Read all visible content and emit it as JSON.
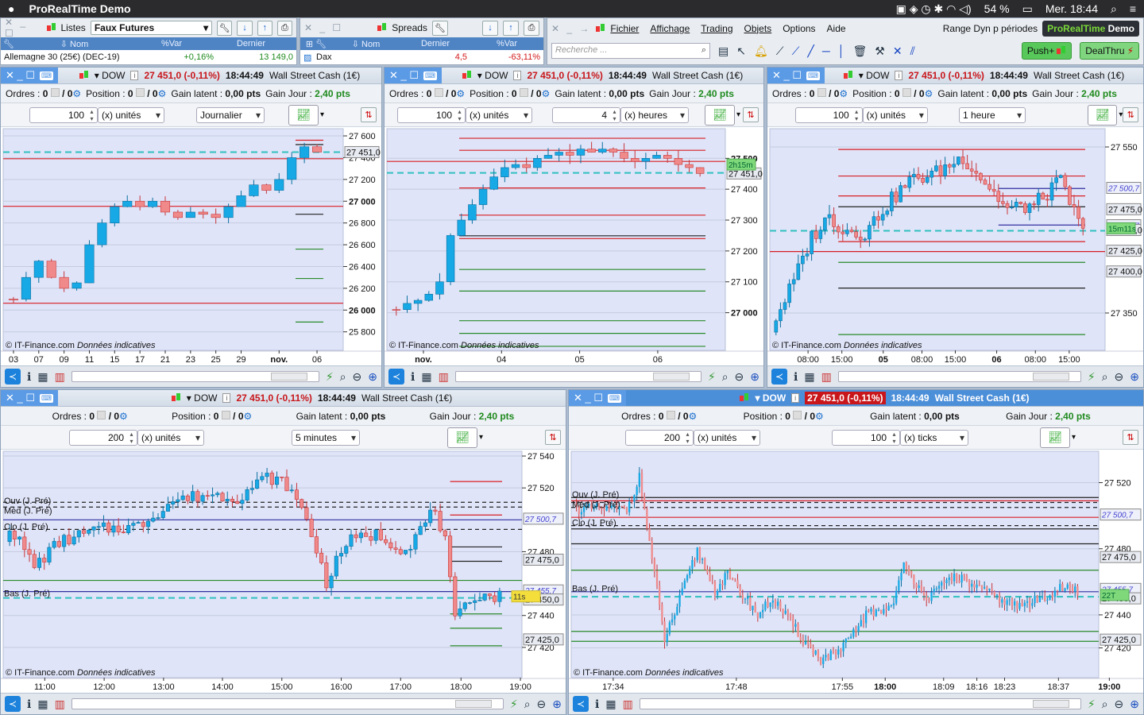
{
  "menubar": {
    "app": "ProRealTime Demo",
    "battery": "54 %",
    "datetime": "Mer. 18:44"
  },
  "lists": {
    "title": "Listes",
    "selected": "Faux Futures",
    "columns": [
      "⇩ Nom",
      "%Var",
      "Dernier"
    ],
    "rows": [
      {
        "name": "Allemagne 30 (25€) (DEC-19)",
        "var": "+0,16%",
        "last": "13 149,0"
      }
    ]
  },
  "spreads": {
    "title": "Spreads",
    "columns": [
      "⇩ Nom",
      "Dernier",
      "%Var"
    ],
    "rows": [
      {
        "name": "Dax",
        "last": "4,5",
        "var": "-63,11%"
      }
    ]
  },
  "main": {
    "menu": [
      "Fichier",
      "Affichage",
      "Trading",
      "Objets",
      "Options",
      "Aide"
    ],
    "range": "Range Dyn p périodes",
    "brand1": "ProRealTime",
    "brand2": " Demo",
    "search_placeholder": "Recherche ...",
    "push": "Push+",
    "dealthru": "DealThru"
  },
  "common": {
    "symbol": "DOW",
    "price": "27 451,0 (-0,11%)",
    "time": "18:44:49",
    "instrument": "Wall Street Cash (1€)",
    "orders": "Ordres :",
    "position": "Position :",
    "zero": "0",
    "slash_zero": "/ 0",
    "gain_latent": "Gain latent :",
    "gain_latent_val": "0,00 pts",
    "gain_jour": "Gain Jour :",
    "gain_jour_val": "2,40 pts",
    "copyright": "© IT-Finance.com",
    "indicative": "Données indicatives"
  },
  "panels": [
    {
      "units": "100",
      "unit_label": "(x) unités",
      "period": "Journalier"
    },
    {
      "units": "100",
      "unit_label": "(x) unités",
      "period2": "4",
      "period2_label": "(x) heures"
    },
    {
      "units": "100",
      "unit_label": "(x) unités",
      "period": "1 heure"
    },
    {
      "units": "200",
      "unit_label": "(x) unités",
      "period": "5 minutes"
    },
    {
      "units": "200",
      "unit_label": "(x) unités",
      "period2": "100",
      "period2_label": "(x) ticks"
    }
  ],
  "chart_data": [
    {
      "type": "candlestick",
      "ylim": [
        25630,
        27666
      ],
      "closes": [
        26100,
        26300,
        26450,
        26300,
        26200,
        26250,
        26600,
        26800,
        26950,
        27000,
        26950,
        27000,
        26900,
        26850,
        26900,
        26880,
        26850,
        26950,
        27050,
        27150,
        27100,
        27200,
        27400,
        27500,
        27451
      ],
      "vol": 60,
      "yticks": [
        {
          "v": 27600,
          "t": "27 600"
        },
        {
          "v": 27400,
          "t": "27 400"
        },
        {
          "v": 27200,
          "t": "27 200"
        },
        {
          "v": 27000,
          "t": "27 000",
          "b": 1
        },
        {
          "v": 26800,
          "t": "26 800"
        },
        {
          "v": 26600,
          "t": "26 600"
        },
        {
          "v": 26400,
          "t": "26 400"
        },
        {
          "v": 26200,
          "t": "26 200"
        },
        {
          "v": 26000,
          "t": "26 000",
          "b": 1
        },
        {
          "v": 25800,
          "t": "25 800"
        }
      ],
      "xticks": [
        {
          "i": 0,
          "t": "03"
        },
        {
          "i": 2,
          "t": "07"
        },
        {
          "i": 4,
          "t": "09"
        },
        {
          "i": 6,
          "t": "11"
        },
        {
          "i": 8,
          "t": "15"
        },
        {
          "i": 10,
          "t": "17"
        },
        {
          "i": 12,
          "t": "21"
        },
        {
          "i": 14,
          "t": "23"
        },
        {
          "i": 16,
          "t": "25"
        },
        {
          "i": 18,
          "t": "29"
        },
        {
          "i": 21,
          "t": "nov.",
          "b": 1
        },
        {
          "i": 24,
          "t": "06"
        }
      ],
      "lines": [
        {
          "p": 27390,
          "c": "#d81e24"
        },
        {
          "p": 26953,
          "c": "#d81e24"
        },
        {
          "p": 26063,
          "c": "#d81e24"
        },
        {
          "p": 27451,
          "c": "#30c0c0",
          "d": "8,5",
          "w": 2
        },
        {
          "p": 27560,
          "c": "#d81e24",
          "from": 22.3
        },
        {
          "p": 27520,
          "c": "#222",
          "from": 22.3
        },
        {
          "p": 26880,
          "c": "#222",
          "from": 22.3
        },
        {
          "p": 26560,
          "c": "#2a8a2a",
          "from": 22.3
        },
        {
          "p": 26290,
          "c": "#2a8a2a",
          "from": 22.3
        },
        {
          "p": 25890,
          "c": "#2a8a2a",
          "from": 22.3
        }
      ],
      "labels": [
        {
          "v": 27451,
          "t": "27 451,0",
          "s": "box"
        }
      ]
    },
    {
      "type": "candlestick",
      "ylim": [
        26878,
        27596
      ],
      "closes": [
        27010,
        27030,
        27040,
        27060,
        27100,
        27250,
        27300,
        27350,
        27400,
        27440,
        27470,
        27480,
        27470,
        27500,
        27510,
        27520,
        27510,
        27530,
        27520,
        27530,
        27520,
        27500,
        27490,
        27500,
        27510,
        27500,
        27480,
        27470,
        27451
      ],
      "vol": 30,
      "yticks": [
        {
          "v": 27500,
          "t": "27 500",
          "b": 1
        },
        {
          "v": 27400,
          "t": "27 400"
        },
        {
          "v": 27300,
          "t": "27 300"
        },
        {
          "v": 27200,
          "t": "27 200"
        },
        {
          "v": 27100,
          "t": "27 100"
        },
        {
          "v": 27000,
          "t": "27 000",
          "b": 1
        }
      ],
      "xticks": [
        {
          "i": 2.5,
          "t": "nov.",
          "b": 1
        },
        {
          "i": 9.7,
          "t": "04"
        },
        {
          "i": 16.9,
          "t": "05"
        },
        {
          "i": 24.1,
          "t": "06"
        }
      ],
      "lines": [
        {
          "p": 27490,
          "c": "#d81e24"
        },
        {
          "p": 27453,
          "c": "#30c0c0",
          "d": "8,5",
          "w": 2
        },
        {
          "p": 27565,
          "c": "#d81e24",
          "from": 5.8
        },
        {
          "p": 27526,
          "c": "#d81e24",
          "from": 5.8
        },
        {
          "p": 27404,
          "c": "#d81e24",
          "from": 5.8
        },
        {
          "p": 27316,
          "c": "#d81e24",
          "from": 5.8
        },
        {
          "p": 27249,
          "c": "#222",
          "from": 5.8
        },
        {
          "p": 27240,
          "c": "#d81e24",
          "from": 5.8
        },
        {
          "p": 27140,
          "c": "#2a8a2a",
          "from": 5.8
        },
        {
          "p": 27070,
          "c": "#2a8a2a",
          "from": 5.8
        },
        {
          "p": 26974,
          "c": "#2a8a2a",
          "from": 5.8
        },
        {
          "p": 26933,
          "c": "#2a8a2a",
          "from": 5.8
        },
        {
          "p": 26891,
          "c": "#2a8a2a",
          "from": 5.8
        }
      ],
      "labels": [
        {
          "v": 27451,
          "t": "27 451,0",
          "s": "box"
        },
        {
          "v": 27480,
          "t": "2h15m",
          "s": "green"
        }
      ]
    },
    {
      "type": "candlestick",
      "ylim": [
        27305,
        27572
      ],
      "n": 70,
      "vol": 12,
      "seed": 3,
      "path": [
        [
          0,
          27345
        ],
        [
          4,
          27388
        ],
        [
          8,
          27442
        ],
        [
          12,
          27466
        ],
        [
          15,
          27451
        ],
        [
          20,
          27446
        ],
        [
          24,
          27475
        ],
        [
          30,
          27509
        ],
        [
          36,
          27519
        ],
        [
          42,
          27538
        ],
        [
          46,
          27514
        ],
        [
          52,
          27475
        ],
        [
          58,
          27480
        ],
        [
          64,
          27509
        ],
        [
          69,
          27446
        ]
      ],
      "yticks": [
        {
          "v": 27550,
          "t": "27 550"
        },
        {
          "v": 27350,
          "t": "27 350"
        }
      ],
      "xticks": [
        {
          "i": 7.2,
          "t": "08:00"
        },
        {
          "i": 14.8,
          "t": "15:00"
        },
        {
          "i": 24.1,
          "t": "05",
          "b": 1
        },
        {
          "i": 32.8,
          "t": "08:00"
        },
        {
          "i": 40.3,
          "t": "15:00"
        },
        {
          "i": 49.6,
          "t": "06",
          "b": 1
        },
        {
          "i": 58.3,
          "t": "08:00"
        },
        {
          "i": 65.9,
          "t": "15:00"
        }
      ],
      "lines": [
        {
          "p": 27424,
          "c": "#d81e24"
        },
        {
          "p": 27449,
          "c": "#30c0c0",
          "d": "8,5",
          "w": 2
        },
        {
          "p": 27547,
          "c": "#d81e24",
          "from": 14
        },
        {
          "p": 27515,
          "c": "#d81e24",
          "from": 14
        },
        {
          "p": 27491,
          "c": "#d81e24",
          "from": 14
        },
        {
          "p": 27478,
          "c": "#222",
          "from": 14
        },
        {
          "p": 27436,
          "c": "#d81e24",
          "from": 14
        },
        {
          "p": 27411,
          "c": "#2a8a2a",
          "from": 14
        },
        {
          "p": 27380,
          "c": "#222",
          "from": 14
        },
        {
          "p": 27324,
          "c": "#2a8a2a",
          "from": 14
        },
        {
          "p": 27500,
          "c": "#3030a0",
          "from": 50
        },
        {
          "p": 27456,
          "c": "#3030a0",
          "from": 50
        }
      ],
      "labels": [
        {
          "v": 27500.7,
          "t": "27 500,7",
          "s": "purple"
        },
        {
          "v": 27475,
          "t": "27 475,0",
          "s": "box"
        },
        {
          "v": 27455.7,
          "t": "27 455,7",
          "s": "purple"
        },
        {
          "v": 27450,
          "t": "27 450,0",
          "s": "box"
        },
        {
          "v": 27452,
          "t": "15m11s",
          "s": "green"
        },
        {
          "v": 27425,
          "t": "27 425,0",
          "s": "box"
        },
        {
          "v": 27400,
          "t": "27 400,0",
          "s": "box"
        }
      ]
    },
    {
      "type": "candlestick",
      "ylim": [
        27401,
        27543
      ],
      "n": 100,
      "vol": 5,
      "seed": 7,
      "path": [
        [
          0,
          27496
        ],
        [
          5,
          27471
        ],
        [
          10,
          27486
        ],
        [
          18,
          27494
        ],
        [
          26,
          27496
        ],
        [
          33,
          27512
        ],
        [
          40,
          27516
        ],
        [
          46,
          27514
        ],
        [
          52,
          27527
        ],
        [
          56,
          27522
        ],
        [
          60,
          27501
        ],
        [
          64,
          27461
        ],
        [
          68,
          27486
        ],
        [
          74,
          27491
        ],
        [
          80,
          27481
        ],
        [
          86,
          27507
        ],
        [
          88,
          27486
        ],
        [
          90,
          27436
        ],
        [
          94,
          27453
        ],
        [
          99,
          27452
        ]
      ],
      "yticks": [
        {
          "v": 27540,
          "t": "27 540"
        },
        {
          "v": 27520,
          "t": "27 520"
        },
        {
          "v": 27480,
          "t": "27 480"
        },
        {
          "v": 27440,
          "t": "27 440"
        },
        {
          "v": 27420,
          "t": "27 420"
        }
      ],
      "xticks": [
        {
          "i": 7.1,
          "t": "11:00"
        },
        {
          "i": 19.1,
          "t": "12:00"
        },
        {
          "i": 31.1,
          "t": "13:00"
        },
        {
          "i": 43,
          "t": "14:00"
        },
        {
          "i": 55,
          "t": "15:00"
        },
        {
          "i": 67,
          "t": "16:00"
        },
        {
          "i": 79,
          "t": "17:00"
        },
        {
          "i": 91.2,
          "t": "18:00"
        },
        {
          "i": 103.2,
          "t": "19:00"
        }
      ],
      "lines": [
        {
          "p": 27511,
          "c": "#222",
          "d": "5,4"
        },
        {
          "p": 27508,
          "c": "#222",
          "d": "5,4"
        },
        {
          "p": 27494,
          "c": "#222",
          "d": "5,4"
        },
        {
          "p": 27500,
          "c": "#3030a0"
        },
        {
          "p": 27462,
          "c": "#2a8a2a"
        },
        {
          "p": 27455,
          "c": "#3030a0"
        },
        {
          "p": 27451,
          "c": "#30c0c0",
          "d": "8,5",
          "w": 2
        },
        {
          "p": 27524,
          "c": "#d81e24",
          "from": 89
        },
        {
          "p": 27503,
          "c": "#d81e24",
          "from": 89
        },
        {
          "p": 27483,
          "c": "#222",
          "from": 89
        },
        {
          "p": 27474,
          "c": "#222",
          "from": 89
        },
        {
          "p": 27441,
          "c": "#2a8a2a",
          "from": 89
        },
        {
          "p": 27432,
          "c": "#2a8a2a",
          "from": 89
        },
        {
          "p": 27421,
          "c": "#2a8a2a",
          "from": 89
        }
      ],
      "tags": [
        {
          "v": 27512,
          "t": "Ouv (J. Pré)"
        },
        {
          "v": 27506,
          "t": "Méd (J. Pré)"
        },
        {
          "v": 27496,
          "t": "Clo (J. Pré)"
        },
        {
          "v": 27454,
          "t": "Bas (J. Pré)"
        }
      ],
      "labels": [
        {
          "v": 27500.7,
          "t": "27 500,7",
          "s": "purple"
        },
        {
          "v": 27475,
          "t": "27 475,0",
          "s": "box"
        },
        {
          "v": 27455.7,
          "t": "27 455,7",
          "s": "purple"
        },
        {
          "v": 27450,
          "t": "27 450,0",
          "s": "box"
        },
        {
          "v": 27452,
          "t": "11s",
          "s": "yellow"
        },
        {
          "v": 27425,
          "t": "27 425,0",
          "s": "box"
        }
      ]
    },
    {
      "type": "candlestick",
      "ylim": [
        27402,
        27539
      ],
      "n": 200,
      "vol": 4,
      "seed": 11,
      "path": [
        [
          0,
          27504
        ],
        [
          20,
          27504
        ],
        [
          25,
          27523
        ],
        [
          30,
          27474
        ],
        [
          35,
          27425
        ],
        [
          40,
          27445
        ],
        [
          48,
          27479
        ],
        [
          55,
          27455
        ],
        [
          60,
          27464
        ],
        [
          72,
          27440
        ],
        [
          78,
          27450
        ],
        [
          90,
          27425
        ],
        [
          97,
          27413
        ],
        [
          105,
          27418
        ],
        [
          115,
          27440
        ],
        [
          125,
          27445
        ],
        [
          130,
          27469
        ],
        [
          140,
          27450
        ],
        [
          150,
          27464
        ],
        [
          165,
          27452
        ],
        [
          175,
          27445
        ],
        [
          185,
          27450
        ],
        [
          192,
          27457
        ],
        [
          199,
          27454
        ]
      ],
      "yticks": [
        {
          "v": 27520,
          "t": "27 520"
        },
        {
          "v": 27480,
          "t": "27 480"
        },
        {
          "v": 27440,
          "t": "27 440"
        },
        {
          "v": 27420,
          "t": "27 420"
        }
      ],
      "xticks": [
        {
          "i": 14.6,
          "t": "17:34"
        },
        {
          "i": 63.5,
          "t": "17:48"
        },
        {
          "i": 105.6,
          "t": "17:55"
        },
        {
          "i": 122.6,
          "t": "18:00",
          "b": 1
        },
        {
          "i": 145.8,
          "t": "18:09"
        },
        {
          "i": 159,
          "t": "18:16"
        },
        {
          "i": 170,
          "t": "18:23"
        },
        {
          "i": 191.4,
          "t": "18:37"
        },
        {
          "i": 211.6,
          "t": "19:00",
          "b": 1
        }
      ],
      "lines": [
        {
          "p": 27508,
          "c": "#222",
          "d": "5,4"
        },
        {
          "p": 27505,
          "c": "#222",
          "d": "5,4"
        },
        {
          "p": 27494,
          "c": "#222",
          "d": "5,4"
        },
        {
          "p": 27511,
          "c": "#222"
        },
        {
          "p": 27509,
          "c": "#d81e24"
        },
        {
          "p": 27499,
          "c": "#d81e24"
        },
        {
          "p": 27492,
          "c": "#222"
        },
        {
          "p": 27483,
          "c": "#222"
        },
        {
          "p": 27467,
          "c": "#2a8a2a"
        },
        {
          "p": 27454,
          "c": "#3030a0"
        },
        {
          "p": 27451,
          "c": "#30c0c0",
          "d": "8,5",
          "w": 2
        },
        {
          "p": 27430,
          "c": "#2a8a2a"
        },
        {
          "p": 27424,
          "c": "#2a8a2a"
        }
      ],
      "tags": [
        {
          "v": 27513,
          "t": "Ouv (J. Pré)"
        },
        {
          "v": 27507,
          "t": "Méd (J. Pré)"
        },
        {
          "v": 27496,
          "t": "Clo (J. Pré)"
        },
        {
          "v": 27456,
          "t": "Bas (J. Pré)"
        }
      ],
      "labels": [
        {
          "v": 27500.7,
          "t": "27 500,7",
          "s": "purple"
        },
        {
          "v": 27475,
          "t": "27 475,0",
          "s": "box"
        },
        {
          "v": 27455.7,
          "t": "27 455,7",
          "s": "purple"
        },
        {
          "v": 27450,
          "t": "27 450,0",
          "s": "box"
        },
        {
          "v": 27452,
          "t": "22T",
          "s": "green"
        },
        {
          "v": 27425,
          "t": "27 425,0",
          "s": "box"
        }
      ]
    }
  ]
}
